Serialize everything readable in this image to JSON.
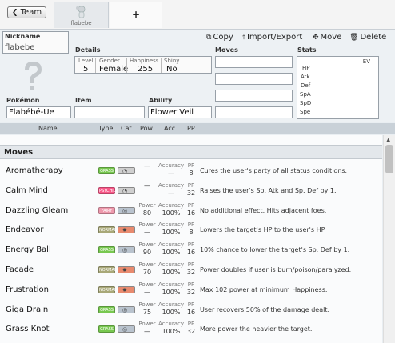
{
  "topbar": {
    "team_button": "Team",
    "pokemon_tab_label": "flabebe",
    "add_tab_label": "+"
  },
  "editor": {
    "nickname_label": "Nickname",
    "nickname_value": "flabebe",
    "details_label": "Details",
    "level_label": "Level",
    "level_value": "5",
    "gender_label": "Gender",
    "gender_value": "Female",
    "happiness_label": "Happiness",
    "happiness_value": "255",
    "shiny_label": "Shiny",
    "shiny_value": "No",
    "moves_label": "Moves",
    "stats_label": "Stats",
    "ev_label": "EV",
    "stat_labels": [
      "HP",
      "Atk",
      "Def",
      "SpA",
      "SpD",
      "Spe"
    ],
    "pokemon_label": "Pokémon",
    "pokemon_value": "Flabébé-Ue",
    "item_label": "Item",
    "item_value": "",
    "ability_label": "Ability",
    "ability_value": "Flower Veil",
    "actions": {
      "copy": "Copy",
      "import_export": "Import/Export",
      "move": "Move",
      "delete": "Delete"
    }
  },
  "columns": {
    "name": "Name",
    "type": "Type",
    "cat": "Cat",
    "pow": "Pow",
    "acc": "Acc",
    "pp": "PP"
  },
  "moves_list": {
    "section_title": "Moves",
    "power_label": "Power",
    "accuracy_label": "Accuracy",
    "pp_label": "PP",
    "rows": [
      {
        "name": "Aromatherapy",
        "type": "GRASS",
        "type_color": "#78c850",
        "category": "status",
        "power": "—",
        "accuracy": "—",
        "pp": "8",
        "desc": "Cures the user's party of all status conditions."
      },
      {
        "name": "Calm Mind",
        "type": "PSYCHIC",
        "type_color": "#f85888",
        "category": "status",
        "power": "—",
        "accuracy": "—",
        "pp": "32",
        "desc": "Raises the user's Sp. Atk and Sp. Def by 1."
      },
      {
        "name": "Dazzling Gleam",
        "type": "FAIRY",
        "type_color": "#ee99ac",
        "category": "special",
        "power": "80",
        "accuracy": "100%",
        "pp": "16",
        "desc": "No additional effect. Hits adjacent foes."
      },
      {
        "name": "Endeavor",
        "type": "NORMAL",
        "type_color": "#a8a878",
        "category": "physical",
        "power": "—",
        "accuracy": "100%",
        "pp": "8",
        "desc": "Lowers the target's HP to the user's HP."
      },
      {
        "name": "Energy Ball",
        "type": "GRASS",
        "type_color": "#78c850",
        "category": "special",
        "power": "90",
        "accuracy": "100%",
        "pp": "16",
        "desc": "10% chance to lower the target's Sp. Def by 1."
      },
      {
        "name": "Facade",
        "type": "NORMAL",
        "type_color": "#a8a878",
        "category": "physical",
        "power": "70",
        "accuracy": "100%",
        "pp": "32",
        "desc": "Power doubles if user is burn/poison/paralyzed."
      },
      {
        "name": "Frustration",
        "type": "NORMAL",
        "type_color": "#a8a878",
        "category": "physical",
        "power": "—",
        "accuracy": "100%",
        "pp": "32",
        "desc": "Max 102 power at minimum Happiness."
      },
      {
        "name": "Giga Drain",
        "type": "GRASS",
        "type_color": "#78c850",
        "category": "special",
        "power": "75",
        "accuracy": "100%",
        "pp": "16",
        "desc": "User recovers 50% of the damage dealt."
      },
      {
        "name": "Grass Knot",
        "type": "GRASS",
        "type_color": "#78c850",
        "category": "special",
        "power": "—",
        "accuracy": "100%",
        "pp": "32",
        "desc": "More power the heavier the target."
      }
    ]
  }
}
